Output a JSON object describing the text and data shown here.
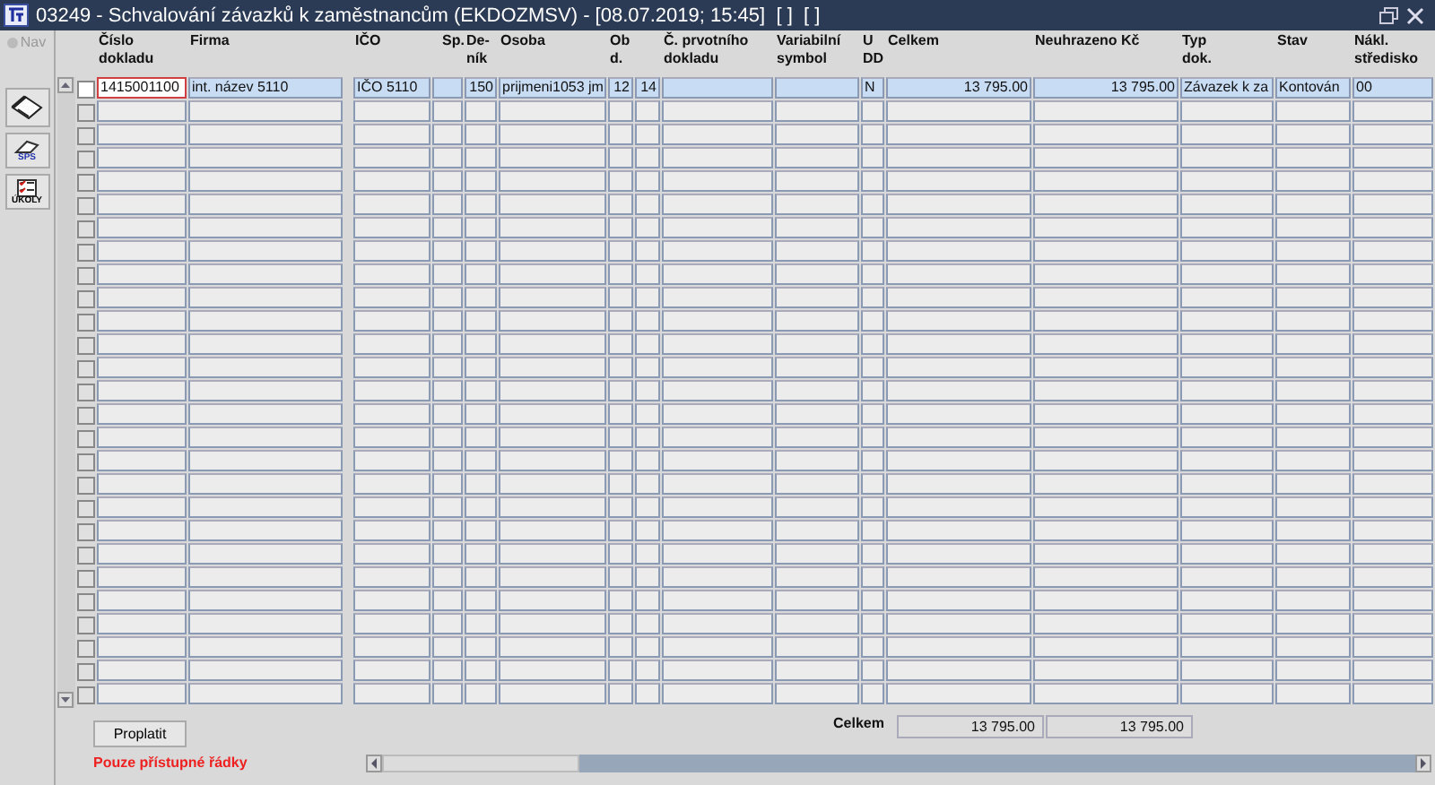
{
  "window": {
    "title": "03249 - Schvalování závazků k zaměstnancům (EKDOZMSV) - [08.07.2019; 15:45]  [ ]  [ ]"
  },
  "toolbar": {
    "nav_label": "Nav",
    "tools": [
      {
        "kind": "eraser"
      },
      {
        "kind": "sps",
        "label": "SPS"
      },
      {
        "kind": "ukoly",
        "label": "ÚKOLY"
      }
    ]
  },
  "table": {
    "columns": [
      {
        "label": "Číslo\ndokladu"
      },
      {
        "label": "Firma"
      },
      {
        "label": "IČO"
      },
      {
        "label": "Sp."
      },
      {
        "label": "De-\nník"
      },
      {
        "label": "Osoba"
      },
      {
        "label": "Ob\nd."
      },
      {},
      {
        "label": "Č. prvotního\ndokladu"
      },
      {
        "label": "Variabilní\nsymbol"
      },
      {
        "label": "U\nDD"
      },
      {
        "label": "Celkem"
      },
      {
        "label": "Neuhrazeno Kč"
      },
      {
        "label": "Typ\ndok."
      },
      {
        "label": "Stav"
      },
      {
        "label": "Nákl.\nstředisko"
      }
    ],
    "rows": [
      {
        "selected": true,
        "checked": false,
        "cells": [
          "1415001100",
          "int. název 5110",
          "IČO 5110",
          "",
          "150",
          "prijmeni1053 jm",
          "12",
          "14",
          "",
          "",
          "N",
          "13 795.00",
          "13 795.00",
          "Závazek k za",
          "Kontován",
          "00"
        ]
      },
      {
        "selected": false,
        "checked": false
      },
      {
        "selected": false,
        "checked": false
      },
      {
        "selected": false,
        "checked": false
      },
      {
        "selected": false,
        "checked": false
      },
      {
        "selected": false,
        "checked": false
      },
      {
        "selected": false,
        "checked": false
      },
      {
        "selected": false,
        "checked": false
      },
      {
        "selected": false,
        "checked": false
      },
      {
        "selected": false,
        "checked": false
      },
      {
        "selected": false,
        "checked": false
      },
      {
        "selected": false,
        "checked": false
      },
      {
        "selected": false,
        "checked": false
      },
      {
        "selected": false,
        "checked": false
      },
      {
        "selected": false,
        "checked": false
      },
      {
        "selected": false,
        "checked": false
      },
      {
        "selected": false,
        "checked": false
      },
      {
        "selected": false,
        "checked": false
      },
      {
        "selected": false,
        "checked": false
      },
      {
        "selected": false,
        "checked": false
      },
      {
        "selected": false,
        "checked": false
      },
      {
        "selected": false,
        "checked": false
      },
      {
        "selected": false,
        "checked": false
      },
      {
        "selected": false,
        "checked": false
      },
      {
        "selected": false,
        "checked": false
      },
      {
        "selected": false,
        "checked": false
      },
      {
        "selected": false,
        "checked": false
      }
    ],
    "totals": {
      "label": "Celkem",
      "values": [
        "13 795.00",
        "13 795.00"
      ]
    }
  },
  "footer": {
    "button": "Proplatit",
    "notice": "Pouze přístupné řádky"
  }
}
